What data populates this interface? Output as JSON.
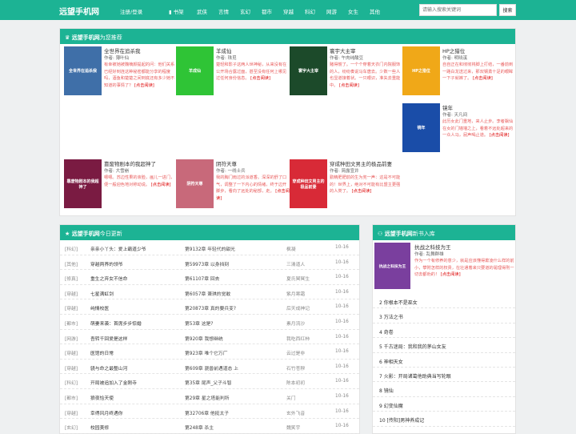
{
  "header": {
    "logo": "远望手机网",
    "login": "注册/登录",
    "nav": [
      "书架",
      "武侠",
      "言情",
      "玄幻",
      "都市",
      "穿越",
      "科幻",
      "网游",
      "女生",
      "其他"
    ],
    "search_placeholder": "请输入搜索关键词",
    "search_button": "搜索"
  },
  "recommend": {
    "title": "远望手机网",
    "subtitle": "为您推荐",
    "read": "[点击阅读]",
    "books": [
      {
        "title": "全世界在追杀我",
        "author": "作者: 薄叶仙",
        "desc": "有幸被她被魏楠颜提起的问：他们关系已经好到连这种秘密都能分享的程度吗，酒鱼和楚楚之间到底还有多少她不知道的事情了？",
        "cover": "全世界在追杀我",
        "color": "#3f6fa8"
      },
      {
        "title": "羊成仙",
        "author": "作者: 珠觅",
        "desc": "楚轻和影子这两人世神秘，从来没有在公开场合露过面，甚至没有任何上哪见过任何身份信息。",
        "cover": "羊成仙",
        "color": "#2fc436"
      },
      {
        "title": "寰宇大主宰",
        "author": "作者: 午肉纯酸豆",
        "desc": "赌得慌了。一个个穿着天衣门内院服饰的人，纷纷奏说马车唐去。少数一些人也显道接着状。一只眼识，准失去重能中。",
        "cover": "寰宇大主宰",
        "color": "#1c4a2a"
      },
      {
        "title": "HP之猎位",
        "author": "作者: 明晓溪",
        "desc": "自自正在和彻彻将脚上打结，一番前到一路白龙送过来，那双钢勇十足的眼眸一下子就裤了。",
        "cover": "HP之猎位",
        "color": "#f0a818"
      },
      {
        "title": "镜年",
        "author": "作者: 天凡间",
        "desc": "此历女此门重地，来人止步。李者飘仙在女的门墙墙之上，看着不远处超来的一众人马，屁声喝止道。",
        "cover": "镜年",
        "color": "#1a4da8"
      },
      {
        "title": "靠废物剧本的我超神了",
        "author": "作者: 大雪崩",
        "desc": "嗯嗯。苏边性果的液脸，画儿一进门，便一般迎色地对称动说。",
        "cover": "靠废物剧本的我超神了",
        "color": "#7a1b42"
      },
      {
        "title": "阴符天尊",
        "author": "作者: 一线士兵",
        "desc": "我的胸门雨过的派道香。深深的舒了口气，调整了一下内心的情绪，终于边开脚步，看向了远处的秘部，走。",
        "cover": "阴符天尊",
        "color": "#c8697a"
      },
      {
        "title": "穿成种田文男主的极品前妻",
        "author": "作者: 简露宣井",
        "desc": "勤精肥肥前的生为兜一声：这是不可能的！世界上，绝对不可能有比盟主更强的人类了。",
        "cover": "穿成种田文男主的极品前妻",
        "color": "#d82a37"
      }
    ]
  },
  "updates": {
    "title": "远望手机网",
    "subtitle": "今日更新",
    "rows": [
      [
        "[科幻]",
        "亲亲小丫头：爱上霸道少爷",
        "第9132章 年轻代的甜光",
        "枫凝",
        "10-16"
      ],
      [
        "[其他]",
        "穿越两界的领爷",
        "第59973章 以身挡刻",
        "三清道人",
        "10-16"
      ],
      [
        "[修真]",
        "重生之弃女不信命",
        "第61107章 回去",
        "夏氏冥冥生",
        "10-16"
      ],
      [
        "[穿越]",
        "七星满虹剑",
        "第6057章 萧琪的觉敢",
        "紫月寒霜",
        "10-16"
      ],
      [
        "[穿越]",
        "纯情校医",
        "第20873章 真的要兵变?",
        "后天成神记",
        "10-16"
      ],
      [
        "[都市]",
        "萌妻来袭：首席步步惊婚",
        "第53章 这是?",
        "素月流沙",
        "10-16"
      ],
      [
        "[网游]",
        "吾转千回爱是这样",
        "第920章 我想继统",
        "我吃西红柿",
        "10-16"
      ],
      [
        "[穿越]",
        "医馆的日常",
        "第923章 唯个它万厂",
        "云过是非",
        "10-16"
      ],
      [
        "[穿越]",
        "骁与命之最整山河",
        "第609章 骁兽前遇道态 上",
        "石竹苍穆",
        "10-16"
      ],
      [
        "[科幻]",
        "开局被追加入了金刚寺",
        "第35章 尾声_父子斗智",
        "陈本初初",
        "10-16"
      ],
      [
        "[都市]",
        "狼夜恰天使",
        "第29章 星之塔能判所",
        "关门",
        "10-16"
      ],
      [
        "[穿越]",
        "幸得风月终遇你",
        "第32706章 他挺太子",
        "玄外飞音",
        "10-16"
      ],
      [
        "[玄幻]",
        "校园美修",
        "第248章 杀主",
        "魏笑宇",
        "10-16"
      ]
    ]
  },
  "newbooks": {
    "title": "远望手机网",
    "subtitle": "新书入库",
    "top": {
      "title": "抗战之科技为王",
      "author": "作者: 乱舞群雄",
      "desc": "作为一个有修养的意少，就是应该懂得欺凌什么样的前小，攀附怎样的权贵，在壮通着来只要道的诞理得刑一切去都劝的！",
      "cover": "抗战之科技为王",
      "color": "#7a3f9e"
    },
    "read": "[点击阅读]",
    "ranks": [
      "2 你根本不是巫女",
      "3 万法之书",
      "4 奇卷",
      "5 千古迷局：我和我的茅山女友",
      "6 神相天女",
      "7 火影：开局诸葛他助典当写轮眼",
      "8 镜仙",
      "9 幻变仙魔",
      "10 [传阳]男神养成记"
    ]
  }
}
